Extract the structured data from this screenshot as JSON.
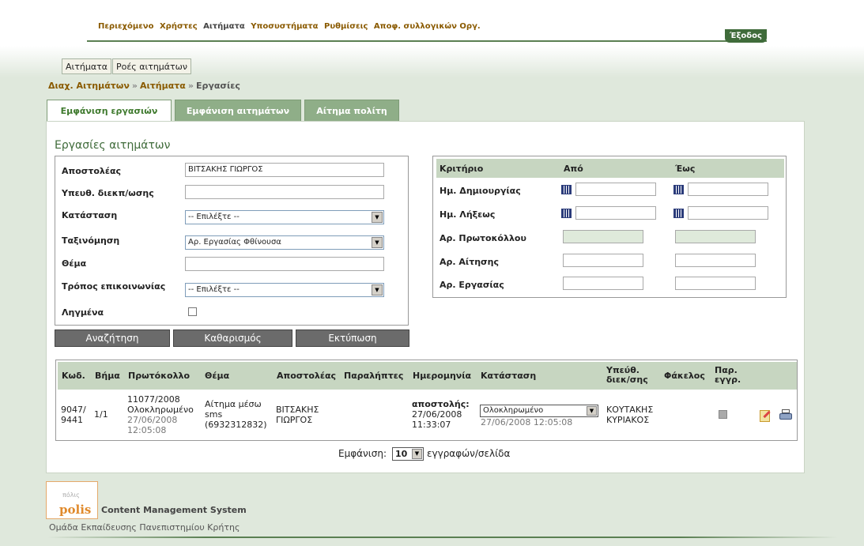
{
  "top_menu": [
    "Περιεχόμενο",
    "Χρήστες",
    "Αιτήματα",
    "Υποσυστήματα",
    "Ρυθμίσεις",
    "Αποφ. συλλογικών Οργ."
  ],
  "logout_label": "Έξοδος",
  "subtabs": [
    "Αιτήματα",
    "Ροές αιτημάτων"
  ],
  "breadcrumb": {
    "items": [
      "Διαχ. Αιτημάτων",
      "Αιτήματα"
    ],
    "current": "Εργασίες",
    "separator": "»"
  },
  "tabs": [
    {
      "label": "Εμφάνιση εργασιών",
      "active": true
    },
    {
      "label": "Εμφάνιση αιτημάτων",
      "active": false
    },
    {
      "label": "Αίτημα πολίτη",
      "active": false
    }
  ],
  "section_title": "Εργασίες αιτημάτων",
  "form": {
    "sender_label": "Αποστολέας",
    "sender_value": "ΒΙΤΣΑΚΗΣ ΓΙΩΡΓΟΣ",
    "manager_label": "Υπευθ. διεκπ/ωσης",
    "manager_value": "",
    "status_label": "Κατάσταση",
    "status_value": "-- Επιλέξτε --",
    "sort_label": "Ταξινόμηση",
    "sort_value": "Αρ. Εργασίας Φθίνουσα",
    "subject_label": "Θέμα",
    "subject_value": "",
    "contact_label": "Τρόπος επικοινωνίας",
    "contact_value": "-- Επιλέξτε --",
    "expired_label": "Ληγμένα",
    "expired_checked": false
  },
  "buttons": {
    "search": "Αναζήτηση",
    "clear": "Καθαρισμός",
    "print": "Εκτύπωση"
  },
  "criteria": {
    "header": {
      "criterion": "Κριτήριο",
      "from": "Από",
      "to": "Έως"
    },
    "rows": [
      {
        "label": "Ημ. Δημιουργίας",
        "calendar": true,
        "readonly": false
      },
      {
        "label": "Ημ. Λήξεως",
        "calendar": true,
        "readonly": false
      },
      {
        "label": "Αρ. Πρωτοκόλλου",
        "calendar": false,
        "readonly": true
      },
      {
        "label": "Αρ. Αίτησης",
        "calendar": false,
        "readonly": false
      },
      {
        "label": "Αρ. Εργασίας",
        "calendar": false,
        "readonly": false
      }
    ]
  },
  "results": {
    "headers": {
      "code": "Κωδ.",
      "step": "Βήμα",
      "protocol": "Πρωτόκολλο",
      "subject": "Θέμα",
      "sender": "Αποστολέας",
      "recipients": "Παραλήπτες",
      "date": "Ημερομηνία",
      "status": "Κατάσταση",
      "manager": "Υπεύθ. διεκ/σης",
      "folder": "Φάκελος",
      "receipt": "Παρ. εγγρ."
    },
    "row": {
      "code": "9047/ 9441",
      "step": "1/1",
      "protocol_no": "11077/2008",
      "protocol_status": "Ολοκληρωμένο",
      "protocol_date": "27/06/2008 12:05:08",
      "subject": "Αίτημα μέσω sms (6932312832)",
      "sender": "ΒΙΤΣΑΚΗΣ ΓΙΩΡΓΟΣ",
      "date_label": "αποστολής:",
      "date_value": "27/06/2008 11:33:07",
      "status_value": "Ολοκληρωμένο",
      "status_date": "27/06/2008 12:05:08",
      "manager": "ΚΟΥΤΑΚΗΣ ΚΥΡΙΑΚΟΣ"
    }
  },
  "pager": {
    "label_before": "Εμφάνιση:",
    "per_page": "10",
    "label_after": "εγγραφών/σελίδα"
  },
  "footer": {
    "logo_text": "polis",
    "logo_greek": "πόλις",
    "cms_label": "Content Management System",
    "team_label": "Ομάδα Εκπαίδευσης Πανεπιστημίου Κρήτης"
  }
}
